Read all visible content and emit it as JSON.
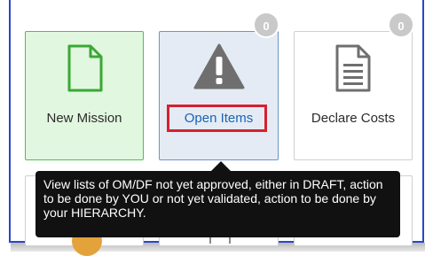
{
  "tiles": {
    "new_mission": {
      "label": "New Mission",
      "icon": "document-icon"
    },
    "open_items": {
      "label": "Open Items",
      "icon": "warning-icon",
      "badge": "0"
    },
    "declare_costs": {
      "label": "Declare Costs",
      "icon": "receipt-icon",
      "badge": "0"
    }
  },
  "tooltip": {
    "text": "View lists of OM/DF not yet approved, either in DRAFT, action to be done by YOU or not yet validated, action to be done by your HIERARCHY."
  },
  "colors": {
    "new_tile_bg": "#e2f7df",
    "new_tile_border": "#4fbf4a",
    "open_tile_bg": "#e5ebf4",
    "open_label": "#1764b4",
    "highlight": "#d6212f",
    "frame_border": "#2a46c8",
    "badge": "#c9c9c9",
    "tooltip_bg": "#111111"
  }
}
